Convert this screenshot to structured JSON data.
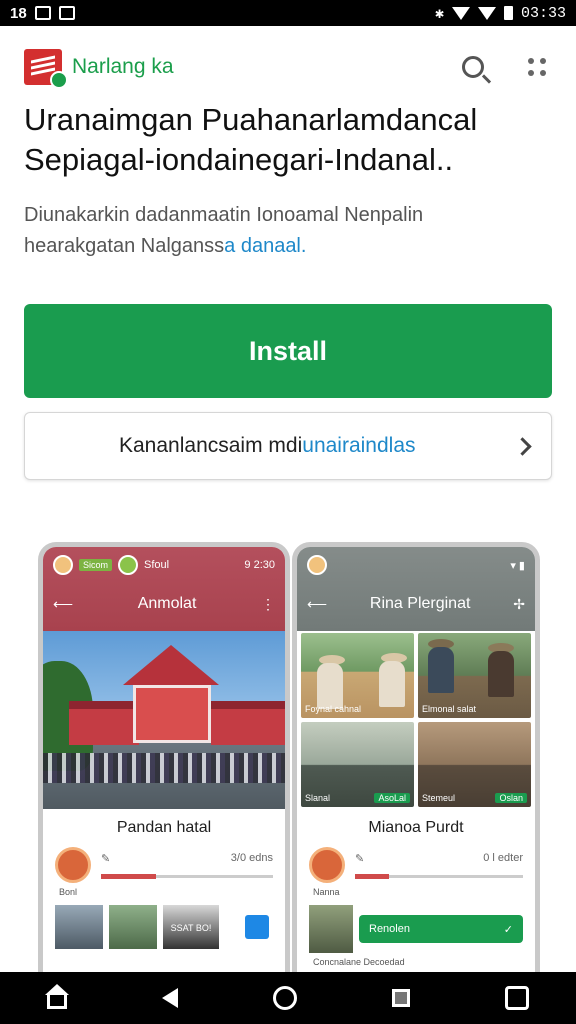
{
  "status_bar": {
    "left_text": "18",
    "time": "03:33"
  },
  "header": {
    "brand_name": "Narlang ka",
    "search_icon": "search-icon",
    "menu_icon": "more-dots-icon"
  },
  "app": {
    "title_line1": "Uranaimgan Puahanarlamdancal",
    "title_line2": "Sepiagal-iondainegari-Indanal..",
    "description_line1": "Diunakarkin dadanmaatin Ionoamal Nenpalin",
    "description_line2_text": "hearakgatan Nalganss",
    "description_line2_link": "a danaal."
  },
  "buttons": {
    "install_label": "Install",
    "secondary_label": "Kananlancsaim mdi",
    "secondary_label_accent": "unairaindlas"
  },
  "screenshots": {
    "phone1": {
      "status_chip1": "Sicom",
      "status_chip2": "Sfoul",
      "status_right": "9 2:30",
      "header_title": "Anmolat",
      "card_title": "Pandan hatal",
      "meta_right": "3/0 edns",
      "caption": "Bonl",
      "thumb_text": "SSAT BO!"
    },
    "phone2": {
      "header_title": "Rina Plerginat",
      "tile1_left": "Foynal cahnal",
      "tile2_left": "Elmonal salat",
      "tile3_left": "Slanal",
      "tile3_badge": "AsoLal",
      "tile4_left": "Stemeul",
      "tile4_badge": "Oslan",
      "card_title": "Mianoa Purdt",
      "meta_right": "0 l edter",
      "caption": "Nanna",
      "button_label": "Renolen",
      "footer_text": "Concnalane Decoedad"
    }
  },
  "colors": {
    "brand_green": "#1a9c4f",
    "accent_blue": "#1e88c9",
    "logo_red": "#d32f2f"
  }
}
